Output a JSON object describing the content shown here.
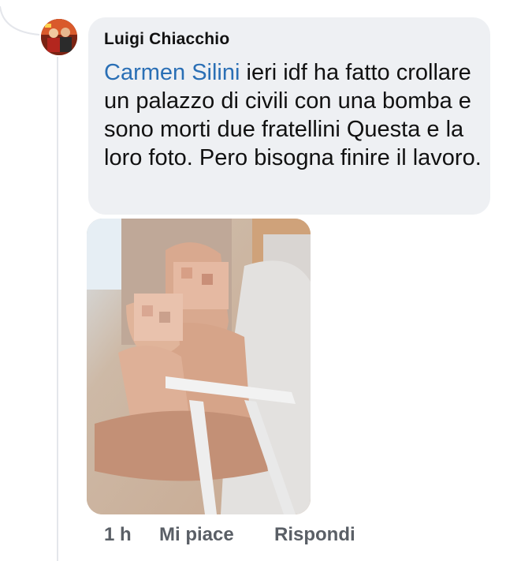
{
  "comment": {
    "author": "Luigi Chiacchio",
    "mention": "Carmen Silini",
    "text": " ieri idf ha fatto crollare un palazzo di civili con una bomba e sono morti due fratellini  Questa e la loro foto. Pero bisogna finire il lavoro.",
    "time": "1 h",
    "like_label": "Mi piace",
    "reply_label": "Rispondi"
  },
  "colors": {
    "bubble": "#eef0f3",
    "mention": "#2a6fb5",
    "action_text": "#5a5f66"
  }
}
